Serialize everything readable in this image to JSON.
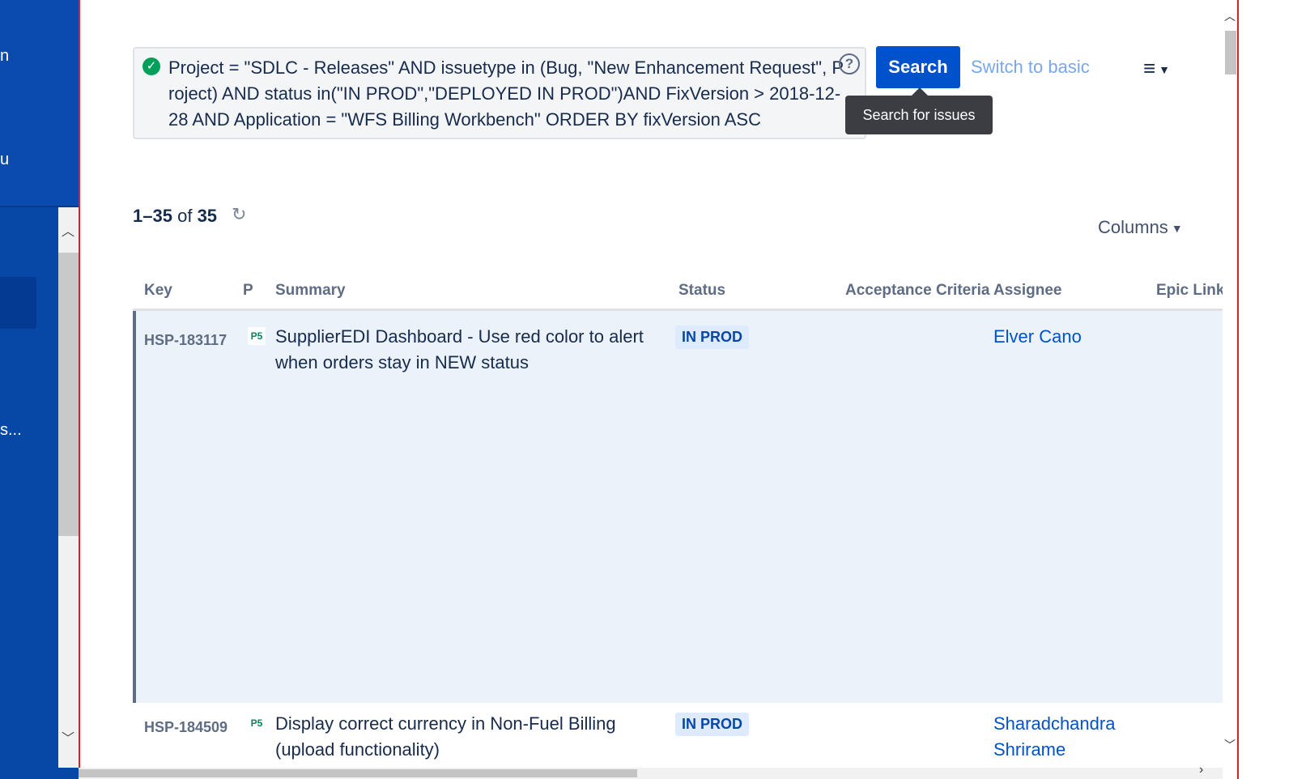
{
  "sidebar": {
    "truncated_labels": [
      {
        "text": "n"
      },
      {
        "text": "u"
      },
      {
        "text": "s..."
      }
    ]
  },
  "jql": {
    "query": "Project = \"SDLC - Releases\" AND issuetype in (Bug, \"New Enhancement Request\", Project) AND status in(\"IN PROD\",\"DEPLOYED IN PROD\")AND FixVersion > 2018-12-28 AND Application = \"WFS Billing Workbench\" ORDER BY fixVersion ASC",
    "valid_icon": "check-circle-icon",
    "help_icon": "question-circle-icon"
  },
  "toolbar": {
    "search_label": "Search",
    "switch_label": "Switch to basic",
    "menu_icon": "hamburger-menu-icon",
    "tooltip": "Search for issues"
  },
  "results": {
    "range": "1–35",
    "of_label": "of",
    "total": "35",
    "refresh_icon": "refresh-icon",
    "columns_label": "Columns"
  },
  "table": {
    "headers": {
      "key": "Key",
      "priority": "P",
      "summary": "Summary",
      "status": "Status",
      "acceptance": "Acceptance Criteria",
      "assignee": "Assignee",
      "epic": "Epic Link"
    },
    "rows": [
      {
        "key": "HSP-183117",
        "priority": "P5",
        "summary": "SupplierEDI Dashboard - Use red color to alert when orders stay in NEW status",
        "status": "IN PROD",
        "assignee": "Elver Cano"
      },
      {
        "key": "HSP-184509",
        "priority": "P5",
        "summary": "Display correct currency in Non-Fuel Billing (upload functionality)",
        "status": "IN PROD",
        "assignee": "Sharadchandra Shrirame"
      }
    ]
  },
  "colors": {
    "sidebar": "#0747a6",
    "primary_button": "#0052cc",
    "selected_row": "#ebf2fa",
    "status_badge": "#deebff"
  }
}
